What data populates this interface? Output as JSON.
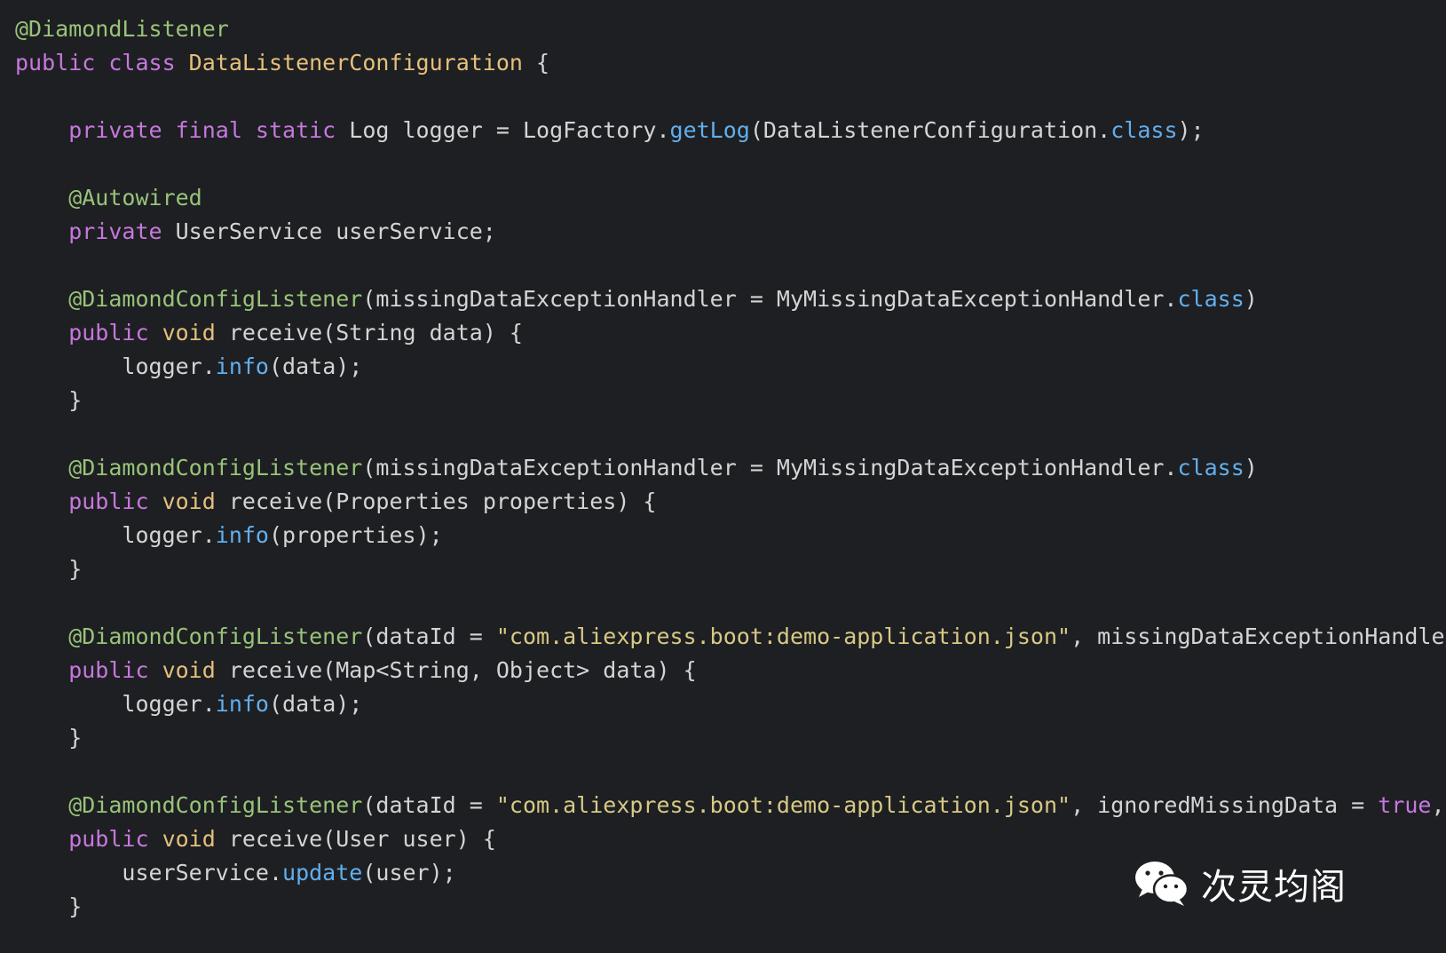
{
  "code": {
    "lines": [
      [
        {
          "t": "@DiamondListener",
          "c": "annotation"
        }
      ],
      [
        {
          "t": "public class ",
          "c": "keyword"
        },
        {
          "t": "DataListenerConfiguration",
          "c": "class-decl"
        },
        {
          "t": " {",
          "c": "plain"
        }
      ],
      [],
      [
        {
          "t": "    private final static ",
          "c": "keyword"
        },
        {
          "t": "Log logger = LogFactory.",
          "c": "plain"
        },
        {
          "t": "getLog",
          "c": "method-call"
        },
        {
          "t": "(DataListenerConfiguration.",
          "c": "plain"
        },
        {
          "t": "class",
          "c": "classlit"
        },
        {
          "t": ");",
          "c": "plain"
        }
      ],
      [],
      [
        {
          "t": "    @Autowired",
          "c": "annotation"
        }
      ],
      [
        {
          "t": "    private ",
          "c": "keyword"
        },
        {
          "t": "UserService userService;",
          "c": "plain"
        }
      ],
      [],
      [
        {
          "t": "    @DiamondConfigListener",
          "c": "annotation"
        },
        {
          "t": "(missingDataExceptionHandler = MyMissingDataExceptionHandler.",
          "c": "plain"
        },
        {
          "t": "class",
          "c": "classlit"
        },
        {
          "t": ")",
          "c": "plain"
        }
      ],
      [
        {
          "t": "    public ",
          "c": "keyword"
        },
        {
          "t": "void ",
          "c": "kw-yellow"
        },
        {
          "t": "receive(String data) {",
          "c": "plain"
        }
      ],
      [
        {
          "t": "        logger.",
          "c": "plain"
        },
        {
          "t": "info",
          "c": "method-call"
        },
        {
          "t": "(data);",
          "c": "plain"
        }
      ],
      [
        {
          "t": "    }",
          "c": "plain"
        }
      ],
      [],
      [
        {
          "t": "    @DiamondConfigListener",
          "c": "annotation"
        },
        {
          "t": "(missingDataExceptionHandler = MyMissingDataExceptionHandler.",
          "c": "plain"
        },
        {
          "t": "class",
          "c": "classlit"
        },
        {
          "t": ")",
          "c": "plain"
        }
      ],
      [
        {
          "t": "    public ",
          "c": "keyword"
        },
        {
          "t": "void ",
          "c": "kw-yellow"
        },
        {
          "t": "receive(Properties properties) {",
          "c": "plain"
        }
      ],
      [
        {
          "t": "        logger.",
          "c": "plain"
        },
        {
          "t": "info",
          "c": "method-call"
        },
        {
          "t": "(properties);",
          "c": "plain"
        }
      ],
      [
        {
          "t": "    }",
          "c": "plain"
        }
      ],
      [],
      [
        {
          "t": "    @DiamondConfigListener",
          "c": "annotation"
        },
        {
          "t": "(dataId = ",
          "c": "plain"
        },
        {
          "t": "\"com.aliexpress.boot:demo-application.json\"",
          "c": "string"
        },
        {
          "t": ", missingDataExceptionHandler",
          "c": "plain"
        }
      ],
      [
        {
          "t": "    public ",
          "c": "keyword"
        },
        {
          "t": "void ",
          "c": "kw-yellow"
        },
        {
          "t": "receive(Map<String, Object> data) {",
          "c": "plain"
        }
      ],
      [
        {
          "t": "        logger.",
          "c": "plain"
        },
        {
          "t": "info",
          "c": "method-call"
        },
        {
          "t": "(data);",
          "c": "plain"
        }
      ],
      [
        {
          "t": "    }",
          "c": "plain"
        }
      ],
      [],
      [
        {
          "t": "    @DiamondConfigListener",
          "c": "annotation"
        },
        {
          "t": "(dataId = ",
          "c": "plain"
        },
        {
          "t": "\"com.aliexpress.boot:demo-application.json\"",
          "c": "string"
        },
        {
          "t": ", ignoredMissingData = ",
          "c": "plain"
        },
        {
          "t": "true",
          "c": "bool"
        },
        {
          "t": ", ",
          "c": "plain"
        }
      ],
      [
        {
          "t": "    public ",
          "c": "keyword"
        },
        {
          "t": "void ",
          "c": "kw-yellow"
        },
        {
          "t": "receive(User user) {",
          "c": "plain"
        }
      ],
      [
        {
          "t": "        userService.",
          "c": "plain"
        },
        {
          "t": "update",
          "c": "method-call"
        },
        {
          "t": "(user);",
          "c": "plain"
        }
      ],
      [
        {
          "t": "    }",
          "c": "plain"
        }
      ]
    ]
  },
  "watermark": {
    "icon": "wechat-icon",
    "text": "次灵均阁"
  }
}
